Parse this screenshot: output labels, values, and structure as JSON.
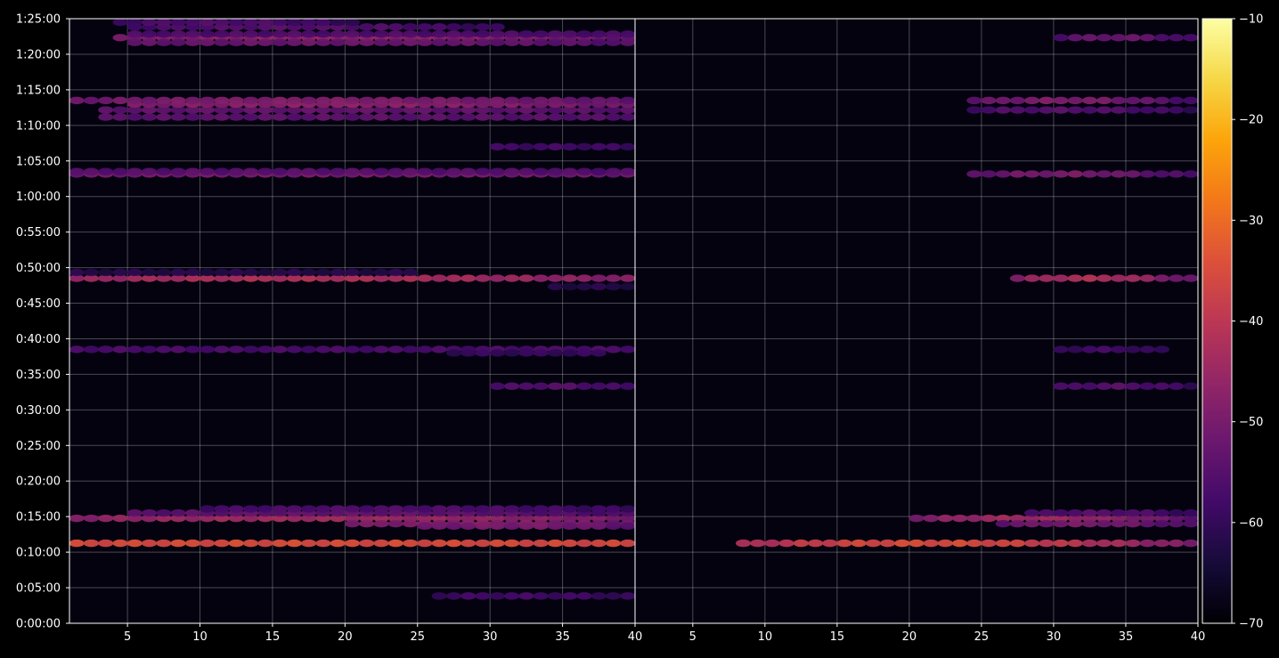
{
  "chart_data": {
    "type": "heatmap",
    "title": "",
    "colormap": "inferno",
    "background": "#000000",
    "grid": true,
    "panels": [
      {
        "name": "",
        "xlim": [
          1,
          40
        ],
        "xticks": [
          5,
          10,
          15,
          20,
          25,
          30,
          35,
          40
        ],
        "ylim_seconds": [
          0,
          5100
        ],
        "yticks": [
          "0:00:00",
          "0:05:00",
          "0:10:00",
          "0:15:00",
          "0:20:00",
          "0:25:00",
          "0:30:00",
          "0:35:00",
          "0:40:00",
          "0:45:00",
          "0:50:00",
          "0:55:00",
          "1:00:00",
          "1:05:00",
          "1:10:00",
          "1:15:00",
          "1:20:00",
          "1:25:00"
        ],
        "bands": [
          {
            "y_seconds": 675,
            "x": [
              1,
              39.5
            ],
            "peak": -35,
            "edge": -37
          },
          {
            "y_seconds": 885,
            "x": [
              1,
              39.5
            ],
            "peak": -44,
            "edge": -55
          },
          {
            "y_seconds": 840,
            "x": [
              20,
              39.5
            ],
            "peak": -48,
            "edge": -55
          },
          {
            "y_seconds": 930,
            "x": [
              5,
              39.5
            ],
            "peak": -53,
            "edge": -60
          },
          {
            "y_seconds": 965,
            "x": [
              10,
              39.5
            ],
            "peak": -56,
            "edge": -62
          },
          {
            "y_seconds": 820,
            "x": [
              25,
              39.5
            ],
            "peak": -50,
            "edge": -58
          },
          {
            "y_seconds": 230,
            "x": [
              26,
              39.5
            ],
            "peak": -58,
            "edge": -62
          },
          {
            "y_seconds": 2000,
            "x": [
              30,
              39.5
            ],
            "peak": -55,
            "edge": -62
          },
          {
            "y_seconds": 2310,
            "x": [
              1,
              39.5
            ],
            "peak": -57,
            "edge": -56
          },
          {
            "y_seconds": 2280,
            "x": [
              27,
              37
            ],
            "peak": -60,
            "edge": -60
          },
          {
            "y_seconds": 2910,
            "x": [
              1,
              39.5
            ],
            "peak": -42,
            "edge": -54
          },
          {
            "y_seconds": 2960,
            "x": [
              1,
              24
            ],
            "peak": -62,
            "edge": -62
          },
          {
            "y_seconds": 2840,
            "x": [
              34,
              39.5
            ],
            "peak": -62,
            "edge": -62
          },
          {
            "y_seconds": 3790,
            "x": [
              1,
              39.5
            ],
            "peak": -50,
            "edge": -53
          },
          {
            "y_seconds": 3810,
            "x": [
              1,
              39.5
            ],
            "peak": -55,
            "edge": -57
          },
          {
            "y_seconds": 4020,
            "x": [
              30,
              39.5
            ],
            "peak": -58,
            "edge": -60
          },
          {
            "y_seconds": 4270,
            "x": [
              3,
              39.5
            ],
            "peak": -54,
            "edge": -56
          },
          {
            "y_seconds": 4330,
            "x": [
              3,
              39.5
            ],
            "peak": -53,
            "edge": -56
          },
          {
            "y_seconds": 4380,
            "x": [
              5,
              39.5
            ],
            "peak": -47,
            "edge": -55
          },
          {
            "y_seconds": 4410,
            "x": [
              1,
              39.5
            ],
            "peak": -49,
            "edge": -57
          },
          {
            "y_seconds": 4940,
            "x": [
              4,
              39.5
            ],
            "peak": -46,
            "edge": -58
          },
          {
            "y_seconds": 4900,
            "x": [
              5,
              39.5
            ],
            "peak": -52,
            "edge": -58
          },
          {
            "y_seconds": 4970,
            "x": [
              5,
              39.5
            ],
            "peak": -56,
            "edge": -58
          },
          {
            "y_seconds": 5030,
            "x": [
              5,
              30
            ],
            "peak": -55,
            "edge": -64
          },
          {
            "y_seconds": 5070,
            "x": [
              4,
              20
            ],
            "peak": -56,
            "edge": -64
          }
        ]
      },
      {
        "name": "",
        "xlim": [
          1,
          40
        ],
        "xticks": [
          5,
          10,
          15,
          20,
          25,
          30,
          35,
          40
        ],
        "ylim_seconds": [
          0,
          5100
        ],
        "bands": [
          {
            "y_seconds": 675,
            "x": [
              8,
              39.5
            ],
            "peak": -35,
            "edge": -62
          },
          {
            "y_seconds": 885,
            "x": [
              20,
              39.5
            ],
            "peak": -44,
            "edge": -62
          },
          {
            "y_seconds": 930,
            "x": [
              28,
              39.5
            ],
            "peak": -55,
            "edge": -64
          },
          {
            "y_seconds": 840,
            "x": [
              26,
              39.5
            ],
            "peak": -50,
            "edge": -62
          },
          {
            "y_seconds": 2000,
            "x": [
              30,
              39.5
            ],
            "peak": -55,
            "edge": -64
          },
          {
            "y_seconds": 2310,
            "x": [
              30,
              37
            ],
            "peak": -58,
            "edge": -64
          },
          {
            "y_seconds": 2910,
            "x": [
              27,
              39.5
            ],
            "peak": -42,
            "edge": -62
          },
          {
            "y_seconds": 3790,
            "x": [
              24,
              39.5
            ],
            "peak": -50,
            "edge": -64
          },
          {
            "y_seconds": 4330,
            "x": [
              24,
              39.5
            ],
            "peak": -55,
            "edge": -64
          },
          {
            "y_seconds": 4410,
            "x": [
              24,
              39.5
            ],
            "peak": -49,
            "edge": -64
          },
          {
            "y_seconds": 4940,
            "x": [
              30,
              39.5
            ],
            "peak": -52,
            "edge": -64
          }
        ]
      }
    ],
    "colorbar": {
      "range": [
        -70,
        -10
      ],
      "ticks": [
        "−10",
        "−20",
        "−30",
        "−40",
        "−50",
        "−60",
        "−70"
      ]
    }
  }
}
